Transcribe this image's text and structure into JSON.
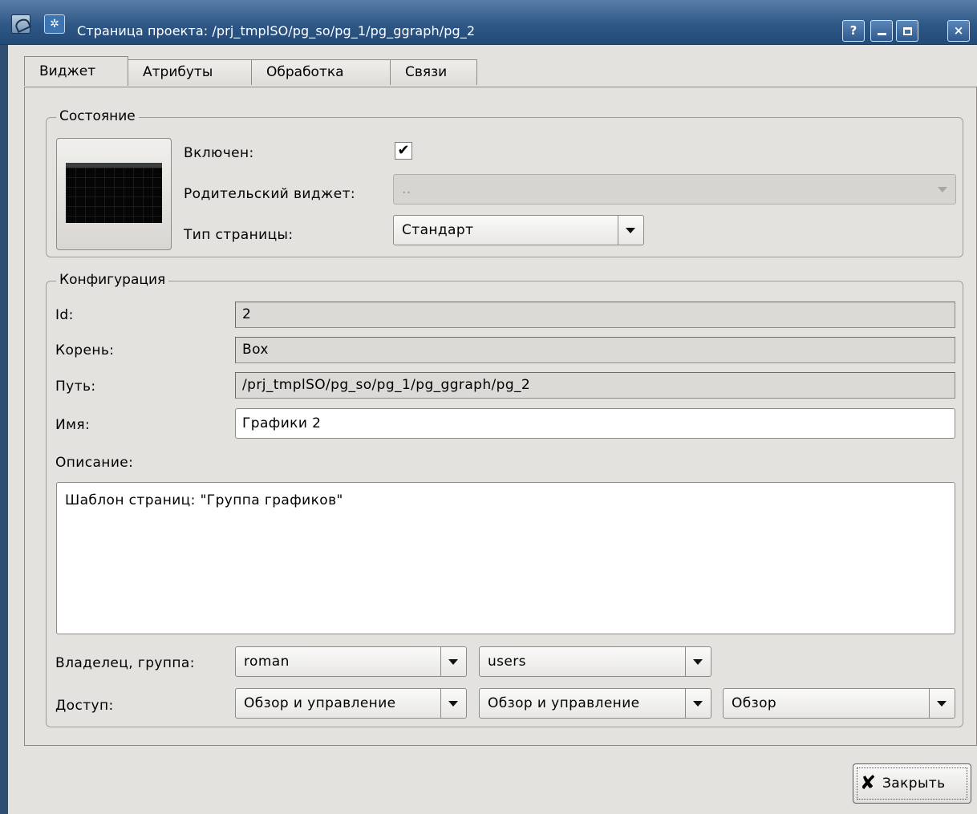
{
  "window": {
    "title": "Страница проекта: /prj_tmplSO/pg_so/pg_1/pg_ggraph/pg_2",
    "help_label": "?",
    "close_label": "×"
  },
  "tabs": [
    {
      "label": "Виджет"
    },
    {
      "label": "Атрибуты"
    },
    {
      "label": "Обработка"
    },
    {
      "label": "Связи"
    }
  ],
  "state": {
    "title": "Состояние",
    "enabled_label": "Включен:",
    "enabled_checked": true,
    "parent_label": "Родительский виджет:",
    "parent_value": "..",
    "page_type_label": "Тип страницы:",
    "page_type_value": "Стандарт"
  },
  "config": {
    "title": "Конфигурация",
    "id_label": "Id:",
    "id_value": "2",
    "root_label": "Корень:",
    "root_value": "Box",
    "path_label": "Путь:",
    "path_value": "/prj_tmplSO/pg_so/pg_1/pg_ggraph/pg_2",
    "name_label": "Имя:",
    "name_value": "Графики 2",
    "description_label": "Описание:",
    "description_value": "Шаблон страниц: \"Группа графиков\"",
    "owner_label": "Владелец, группа:",
    "owner_value": "roman",
    "group_value": "users",
    "access_label": "Доступ:",
    "access_user": "Обзор и управление",
    "access_group": "Обзор и управление",
    "access_other": "Обзор"
  },
  "buttons": {
    "close_label": "Закрыть"
  }
}
